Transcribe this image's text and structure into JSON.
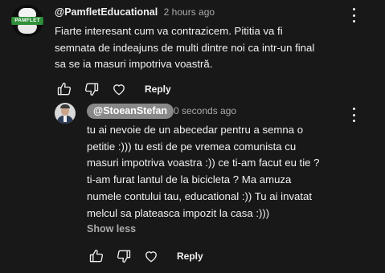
{
  "comment": {
    "author": "@PamfletEducational",
    "timestamp": "2 hours ago",
    "avatar_text": "PAMFLET",
    "lines": [
      "Fiarte interesant cum va contrazicem. Pititia va fi",
      "semnata de indeajuns de multi dintre noi ca intr-un final",
      "sa se ia masuri impotriva voastră."
    ],
    "reply_label": "Reply",
    "icons": [
      "thumb-up-icon",
      "thumb-down-icon",
      "heart-icon",
      "more-vert-icon"
    ]
  },
  "reply": {
    "author": "@StoeanStefan",
    "timestamp": "0 seconds ago",
    "lines": [
      "tu ai nevoie de un abecedar pentru a semna o",
      "petitie :))) tu esti de pe vremea comunista cu",
      "masuri impotriva voastra :)) ce ti-am facut eu tie ?",
      "ti-am furat lantul de la bicicleta ? Ma amuza",
      "numele contului tau, educational :)) Tu ai invatat",
      "melcul sa plateasca impozit la casa :)))"
    ],
    "show_less_label": "Show less",
    "reply_label": "Reply",
    "icons": [
      "thumb-up-icon",
      "thumb-down-icon",
      "heart-icon",
      "more-vert-icon"
    ]
  },
  "colors": {
    "background": "#181818",
    "text": "#f1f1f1",
    "secondary_text": "#aaaaaa",
    "mention_chip": "#888888",
    "logo_green": "#2f8f3a"
  }
}
